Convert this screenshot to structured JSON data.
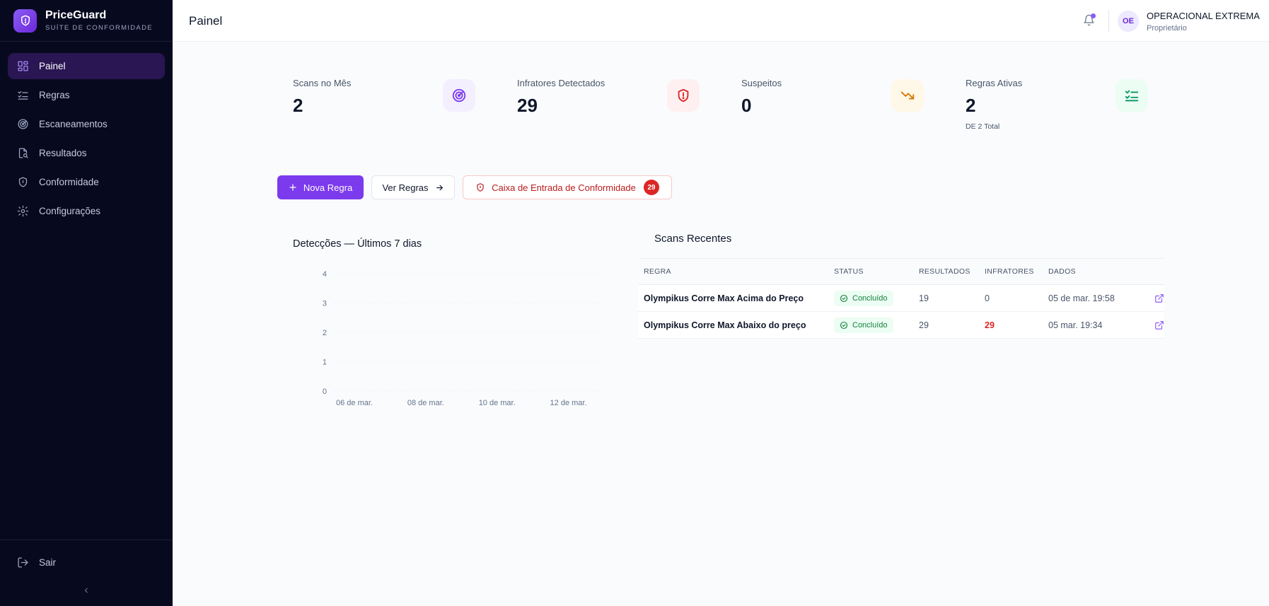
{
  "brand": {
    "name": "PriceGuard",
    "subtitle": "SUÍTE DE CONFORMIDADE"
  },
  "sidebar": {
    "items": [
      {
        "label": "Painel",
        "icon": "dashboard-grid-icon",
        "active": true
      },
      {
        "label": "Regras",
        "icon": "list-check-icon",
        "active": false
      },
      {
        "label": "Escaneamentos",
        "icon": "radar-icon",
        "active": false
      },
      {
        "label": "Resultados",
        "icon": "file-search-icon",
        "active": false
      },
      {
        "label": "Conformidade",
        "icon": "shield-icon",
        "active": false
      },
      {
        "label": "Configurações",
        "icon": "gear-icon",
        "active": false
      }
    ],
    "logout_label": "Sair"
  },
  "header": {
    "title": "Painel",
    "user_initials": "OE",
    "user_name": "OPERACIONAL EXTREMA",
    "user_role": "Proprietário"
  },
  "stats": [
    {
      "label": "Scans no Mês",
      "value": "2",
      "sub": "",
      "icon": "radar-icon",
      "color": "#7c3aed",
      "bg": "#f3efff"
    },
    {
      "label": "Infratores Detectados",
      "value": "29",
      "sub": "",
      "icon": "shield-alert-icon",
      "color": "#dc2626",
      "bg": "#fef0f0"
    },
    {
      "label": "Suspeitos",
      "value": "0",
      "sub": "",
      "icon": "trending-down-icon",
      "color": "#d97706",
      "bg": "#fff8e8"
    },
    {
      "label": "Regras Ativas",
      "value": "2",
      "sub": "DE 2 Total",
      "icon": "list-check-icon",
      "color": "#059669",
      "bg": "#ecfdf3"
    }
  ],
  "actions": {
    "new_rule": "Nova Regra",
    "view_rules": "Ver Regras",
    "compliance_inbox": "Caixa de Entrada de Conformidade",
    "inbox_count": "29"
  },
  "chart_data": {
    "type": "line",
    "title": "Detecções — Últimos 7 dias",
    "xlabel": "",
    "ylabel": "",
    "ylim": [
      0,
      4
    ],
    "yticks": [
      "0",
      "1",
      "2",
      "3",
      "4"
    ],
    "xticks": [
      "06 de mar.",
      "08 de mar.",
      "10 de mar.",
      "12 de mar."
    ],
    "grid": true,
    "series": []
  },
  "recent_scans": {
    "title": "Scans Recentes",
    "columns": [
      "REGRA",
      "STATUS",
      "RESULTADOS",
      "INFRATORES",
      "DADOS"
    ],
    "rows": [
      {
        "rule": "Olympikus Corre Max Acima do Preço",
        "status": "Concluído",
        "results": "19",
        "violators": "0",
        "date": "05 de mar. 19:58"
      },
      {
        "rule": "Olympikus Corre Max Abaixo do preço",
        "status": "Concluído",
        "results": "29",
        "violators": "29",
        "date": "05 mar. 19:34"
      }
    ]
  }
}
